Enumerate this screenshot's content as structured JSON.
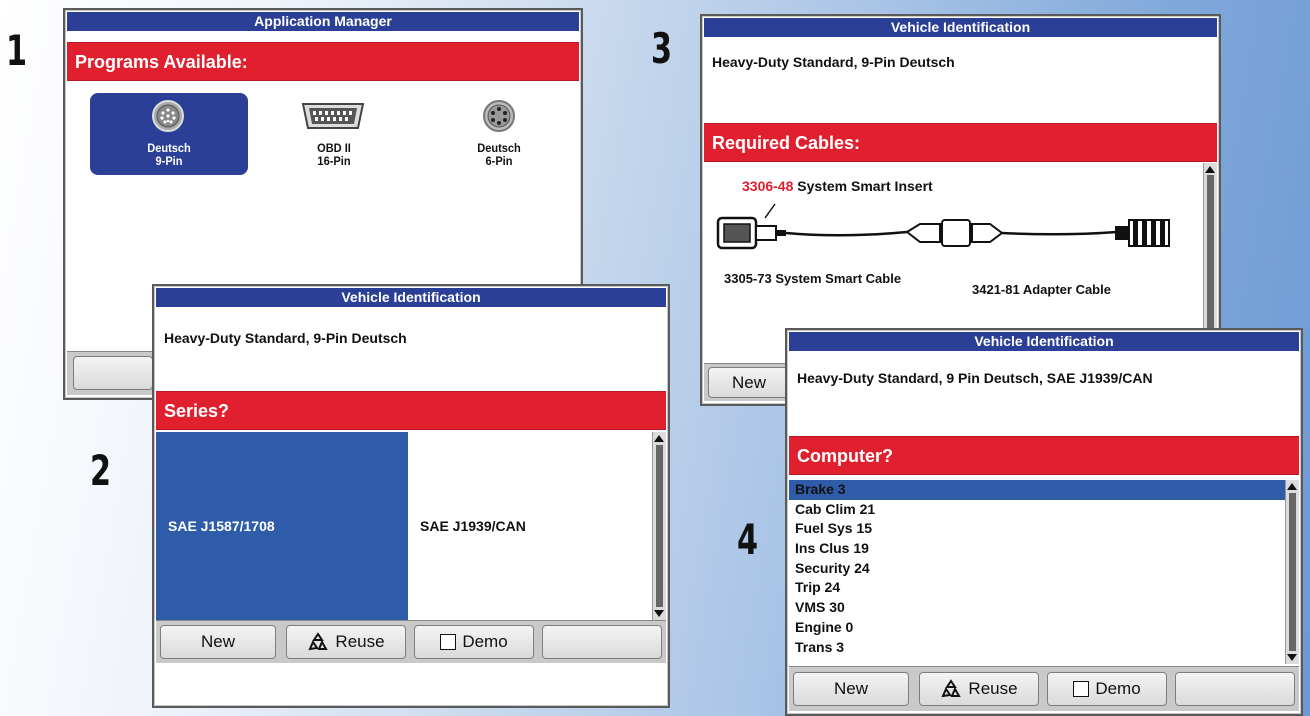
{
  "steps": {
    "s1": "1",
    "s2": "2",
    "s3": "3",
    "s4": "4"
  },
  "win1": {
    "title": "Application Manager",
    "header": "Programs Available:",
    "connectors": [
      {
        "line1": "Deutsch",
        "line2": "9-Pin",
        "selected": true
      },
      {
        "line1": "OBD II",
        "line2": "16-Pin",
        "selected": false
      },
      {
        "line1": "Deutsch",
        "line2": "6-Pin",
        "selected": false
      }
    ]
  },
  "win2": {
    "title": "Vehicle Identification",
    "info": "Heavy-Duty Standard, 9-Pin Deutsch",
    "header": "Series?",
    "options": [
      {
        "label": "SAE J1587/1708",
        "selected": true
      },
      {
        "label": "SAE J1939/CAN",
        "selected": false
      }
    ],
    "buttons": {
      "new": "New",
      "reuse": "Reuse",
      "demo": "Demo"
    }
  },
  "win3": {
    "title": "Vehicle Identification",
    "info": "Heavy-Duty Standard, 9-Pin Deutsch",
    "header": "Required Cables:",
    "insert_part": "3306-48",
    "insert_name": "System Smart Insert",
    "cable1": "3305-73 System Smart Cable",
    "cable2": "3421-81 Adapter Cable",
    "buttons": {
      "new": "New"
    }
  },
  "win4": {
    "title": "Vehicle Identification",
    "info": "Heavy-Duty Standard, 9 Pin Deutsch, SAE J1939/CAN",
    "header": "Computer?",
    "items": [
      "Brake 3",
      "Cab Clim 21",
      "Fuel Sys 15",
      "Ins Clus 19",
      "Security 24",
      "Trip 24",
      "VMS 30",
      "Engine 0",
      "Trans 3"
    ],
    "buttons": {
      "new": "New",
      "reuse": "Reuse",
      "demo": "Demo"
    }
  },
  "colors": {
    "titlebar": "#2a3f95",
    "header": "#e0202f",
    "selection": "#2e5ca8",
    "accent_part": "#e0202f"
  }
}
